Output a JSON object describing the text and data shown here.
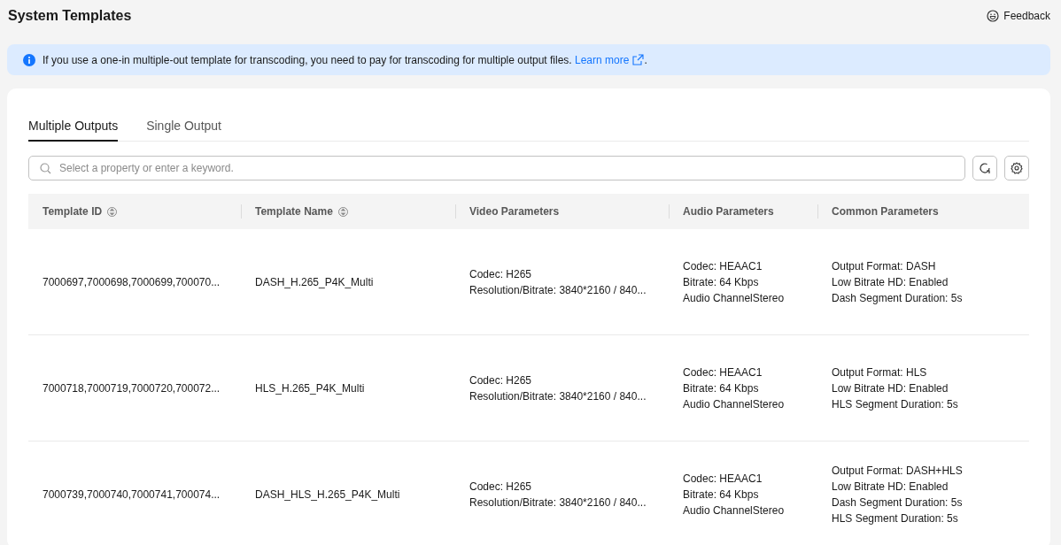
{
  "header": {
    "title": "System Templates",
    "feedback": "Feedback"
  },
  "notice": {
    "text": "If you use a one-in multiple-out template for transcoding, you need to pay for transcoding for multiple output files.",
    "link": "Learn more",
    "suffix": "."
  },
  "tabs": [
    {
      "label": "Multiple Outputs",
      "selected": true
    },
    {
      "label": "Single Output",
      "selected": false
    }
  ],
  "search": {
    "placeholder": "Select a property or enter a keyword."
  },
  "table": {
    "columns": [
      {
        "label": "Template ID",
        "sortable": true
      },
      {
        "label": "Template Name",
        "sortable": true
      },
      {
        "label": "Video Parameters",
        "sortable": false
      },
      {
        "label": "Audio Parameters",
        "sortable": false
      },
      {
        "label": "Common Parameters",
        "sortable": false
      }
    ],
    "rows": [
      {
        "cells": [
          [
            "7000697,7000698,7000699,700070..."
          ],
          [
            "DASH_H.265_P4K_Multi"
          ],
          [
            "Codec: H265",
            "Resolution/Bitrate: 3840*2160 / 840..."
          ],
          [
            "Codec: HEAAC1",
            "Bitrate: 64 Kbps",
            "Audio ChannelStereo"
          ],
          [
            "Output Format: DASH",
            "Low Bitrate HD: Enabled",
            "Dash Segment Duration: 5s"
          ]
        ]
      },
      {
        "cells": [
          [
            "7000718,7000719,7000720,700072..."
          ],
          [
            "HLS_H.265_P4K_Multi"
          ],
          [
            "Codec: H265",
            "Resolution/Bitrate: 3840*2160 / 840..."
          ],
          [
            "Codec: HEAAC1",
            "Bitrate: 64 Kbps",
            "Audio ChannelStereo"
          ],
          [
            "Output Format: HLS",
            "Low Bitrate HD: Enabled",
            "HLS Segment Duration: 5s"
          ]
        ]
      },
      {
        "cells": [
          [
            "7000739,7000740,7000741,700074..."
          ],
          [
            "DASH_HLS_H.265_P4K_Multi"
          ],
          [
            "Codec: H265",
            "Resolution/Bitrate: 3840*2160 / 840..."
          ],
          [
            "Codec: HEAAC1",
            "Bitrate: 64 Kbps",
            "Audio ChannelStereo"
          ],
          [
            "Output Format: DASH+HLS",
            "Low Bitrate HD: Enabled",
            "Dash Segment Duration: 5s",
            "HLS Segment Duration: 5s"
          ]
        ]
      }
    ]
  }
}
